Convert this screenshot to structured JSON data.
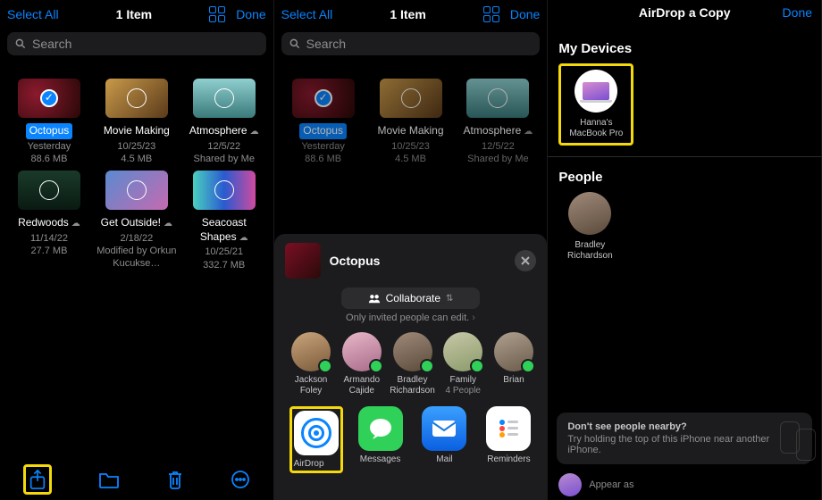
{
  "header": {
    "select_all": "Select All",
    "title": "1 Item",
    "done": "Done"
  },
  "search": {
    "placeholder": "Search"
  },
  "files": [
    {
      "name": "Octopus",
      "date": "Yesterday",
      "size": "88.6 MB",
      "selected": true,
      "cloud": false,
      "thumb_class": "t-oct"
    },
    {
      "name": "Movie Making",
      "date": "10/25/23",
      "size": "4.5 MB",
      "selected": false,
      "cloud": false,
      "thumb_class": "t-mov"
    },
    {
      "name": "Atmosphere",
      "date": "12/5/22",
      "size": "Shared by Me",
      "selected": false,
      "cloud": true,
      "thumb_class": "t-atm"
    },
    {
      "name": "Redwoods",
      "date": "11/14/22",
      "size": "27.7 MB",
      "selected": false,
      "cloud": true,
      "thumb_class": "t-red"
    },
    {
      "name": "Get Outside!",
      "date": "2/18/22",
      "size": "Modified by Orkun Kucukse…",
      "selected": false,
      "cloud": true,
      "thumb_class": "t-get"
    },
    {
      "name": "Seacoast Shapes",
      "date": "10/25/21",
      "size": "332.7 MB",
      "selected": false,
      "cloud": true,
      "thumb_class": "t-sea"
    }
  ],
  "share_sheet": {
    "title": "Octopus",
    "mode": "Collaborate",
    "note": "Only invited people can edit.",
    "contacts": [
      {
        "name": "Jackson Foley",
        "avatar_class": "av1"
      },
      {
        "name": "Armando Cajide",
        "avatar_class": "av2"
      },
      {
        "name": "Bradley Richardson",
        "avatar_class": "av3"
      },
      {
        "name": "Family",
        "sub": "4 People",
        "avatar_class": "av4"
      },
      {
        "name": "Brian",
        "avatar_class": "av5"
      }
    ],
    "apps": [
      {
        "name": "AirDrop",
        "highlight": true
      },
      {
        "name": "Messages"
      },
      {
        "name": "Mail"
      },
      {
        "name": "Reminders"
      }
    ]
  },
  "airdrop": {
    "title": "AirDrop a Copy",
    "done": "Done",
    "devices_label": "My Devices",
    "people_label": "People",
    "device": {
      "name": "Hanna's MacBook Pro"
    },
    "person": {
      "name": "Bradley Richardson"
    },
    "hint_title": "Don't see people nearby?",
    "hint_body": "Try holding the top of this iPhone near another iPhone.",
    "appear": "Appear as"
  }
}
